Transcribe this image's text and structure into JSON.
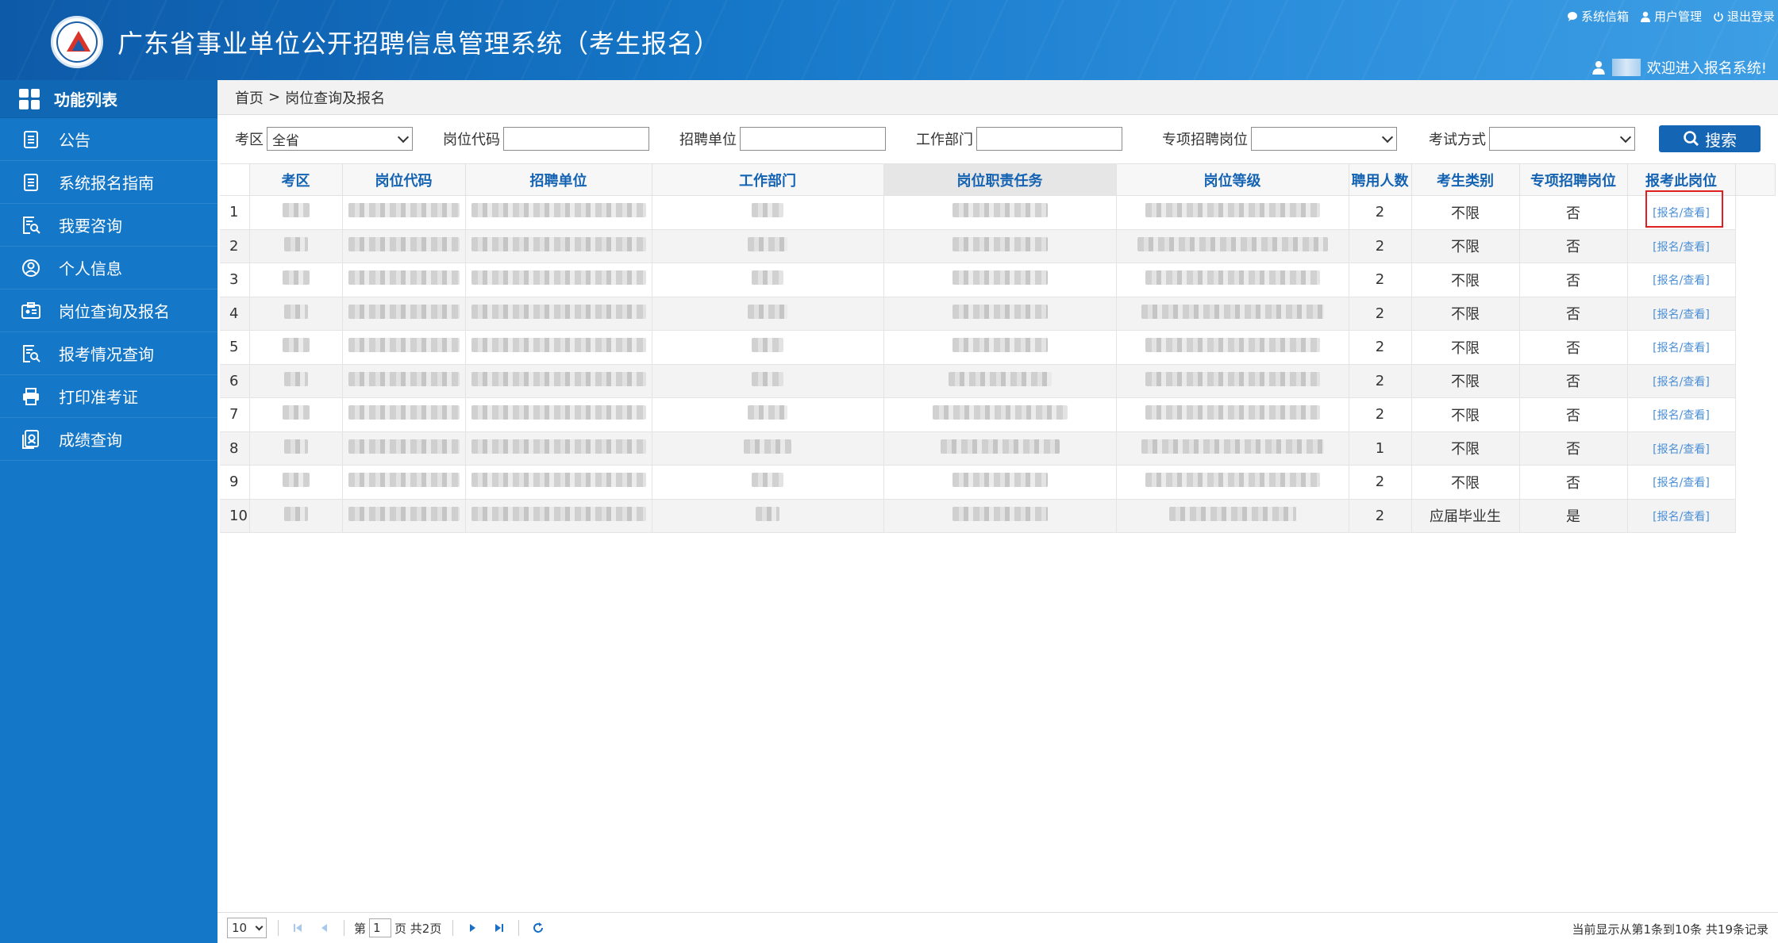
{
  "header": {
    "title": "广东省事业单位公开招聘信息管理系统（考生报名）",
    "links": [
      "系统信箱",
      "用户管理",
      "退出登录"
    ],
    "welcome": "欢迎进入报名系统!"
  },
  "sidebar": {
    "title": "功能列表",
    "items": [
      {
        "label": "公告",
        "icon": "document-list-icon"
      },
      {
        "label": "系统报名指南",
        "icon": "document-list-icon"
      },
      {
        "label": "我要咨询",
        "icon": "search-document-icon"
      },
      {
        "label": "个人信息",
        "icon": "user-circle-icon"
      },
      {
        "label": "岗位查询及报名",
        "icon": "id-card-icon"
      },
      {
        "label": "报考情况查询",
        "icon": "search-document-icon"
      },
      {
        "label": "打印准考证",
        "icon": "printer-icon"
      },
      {
        "label": "成绩查询",
        "icon": "score-search-icon"
      }
    ]
  },
  "breadcrumb": {
    "home": "首页",
    "sep": ">",
    "current": "岗位查询及报名"
  },
  "filters": {
    "region_label": "考区",
    "region_value": "全省",
    "code_label": "岗位代码",
    "unit_label": "招聘单位",
    "dept_label": "工作部门",
    "special_label": "专项招聘岗位",
    "exam_label": "考试方式",
    "search_label": "搜索"
  },
  "table": {
    "headers": [
      "考区",
      "岗位代码",
      "招聘单位",
      "工作部门",
      "岗位职责任务",
      "岗位等级",
      "聘用人数",
      "考生类别",
      "专项招聘岗位",
      "报考此岗位"
    ],
    "rows": [
      {
        "no": "1",
        "count": "2",
        "category": "不限",
        "special": "否",
        "action": "[报名/查看]"
      },
      {
        "no": "2",
        "count": "2",
        "category": "不限",
        "special": "否",
        "action": "[报名/查看]"
      },
      {
        "no": "3",
        "count": "2",
        "category": "不限",
        "special": "否",
        "action": "[报名/查看]"
      },
      {
        "no": "4",
        "count": "2",
        "category": "不限",
        "special": "否",
        "action": "[报名/查看]"
      },
      {
        "no": "5",
        "count": "2",
        "category": "不限",
        "special": "否",
        "action": "[报名/查看]"
      },
      {
        "no": "6",
        "count": "2",
        "category": "不限",
        "special": "否",
        "action": "[报名/查看]"
      },
      {
        "no": "7",
        "count": "2",
        "category": "不限",
        "special": "否",
        "action": "[报名/查看]"
      },
      {
        "no": "8",
        "count": "1",
        "category": "不限",
        "special": "否",
        "action": "[报名/查看]"
      },
      {
        "no": "9",
        "count": "2",
        "category": "不限",
        "special": "否",
        "action": "[报名/查看]"
      },
      {
        "no": "10",
        "count": "2",
        "category": "应届毕业生",
        "special": "是",
        "action": "[报名/查看]"
      }
    ]
  },
  "pager": {
    "page_size": "10",
    "page_prefix": "第",
    "page_value": "1",
    "page_suffix": "页 共2页",
    "info": "当前显示从第1条到10条 共19条记录"
  },
  "colors": {
    "header": "#1576c7",
    "sidebar": "#1577c7",
    "accent": "#1463b3",
    "highlight": "#e02020"
  }
}
